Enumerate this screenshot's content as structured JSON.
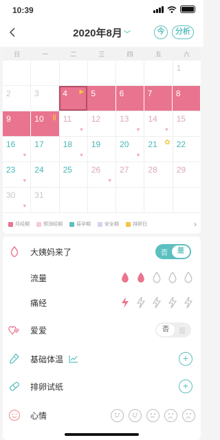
{
  "status_bar": {
    "time": "10:39"
  },
  "header": {
    "month_title": "2020年8月",
    "today_label": "今",
    "analyze_label": "分析"
  },
  "weekdays": [
    "日",
    "一",
    "二",
    "三",
    "四",
    "五",
    "六"
  ],
  "calendar": {
    "rows": [
      [
        {
          "d": ""
        },
        {
          "d": ""
        },
        {
          "d": ""
        },
        {
          "d": ""
        },
        {
          "d": ""
        },
        {
          "d": ""
        },
        {
          "d": "1",
          "c": "grey"
        }
      ],
      [
        {
          "d": "2",
          "c": "grey"
        },
        {
          "d": "3",
          "c": "grey"
        },
        {
          "d": "4",
          "c": "period",
          "sel": true,
          "mark": "flag"
        },
        {
          "d": "5",
          "c": "period"
        },
        {
          "d": "6",
          "c": "period"
        },
        {
          "d": "7",
          "c": "period"
        },
        {
          "d": "8",
          "c": "period"
        }
      ],
      [
        {
          "d": "9",
          "c": "period"
        },
        {
          "d": "10",
          "c": "period",
          "mark": "pause"
        },
        {
          "d": "11",
          "c": "pred",
          "heart": true
        },
        {
          "d": "12",
          "c": "pred"
        },
        {
          "d": "13",
          "c": "pred",
          "heart": true
        },
        {
          "d": "14",
          "c": "pred",
          "heart": true
        },
        {
          "d": "15",
          "c": "pred"
        }
      ],
      [
        {
          "d": "16",
          "c": "teal",
          "heart": true
        },
        {
          "d": "17",
          "c": "teal"
        },
        {
          "d": "18",
          "c": "teal",
          "heart": true
        },
        {
          "d": "19",
          "c": "teal"
        },
        {
          "d": "20",
          "c": "teal",
          "heart": true
        },
        {
          "d": "21",
          "c": "teal",
          "mark": "sun"
        },
        {
          "d": "22",
          "c": "teal"
        }
      ],
      [
        {
          "d": "23",
          "c": "teal",
          "heart": true
        },
        {
          "d": "24",
          "c": "teal"
        },
        {
          "d": "25",
          "c": "teal"
        },
        {
          "d": "26",
          "c": "pred",
          "heart": true
        },
        {
          "d": "27",
          "c": "pred"
        },
        {
          "d": "28",
          "c": "pred"
        },
        {
          "d": "29",
          "c": "pred"
        }
      ],
      [
        {
          "d": "30",
          "c": "grey",
          "heart": true
        },
        {
          "d": "31",
          "c": "grey"
        },
        {
          "d": ""
        },
        {
          "d": ""
        },
        {
          "d": ""
        },
        {
          "d": ""
        },
        {
          "d": ""
        }
      ]
    ]
  },
  "legend": [
    {
      "label": "月经期",
      "color": "#e9748f"
    },
    {
      "label": "预测经期",
      "color": "#f7c9d6"
    },
    {
      "label": "易孕期",
      "color": "#5dbfbf"
    },
    {
      "label": "安全期",
      "color": "#d9d0f0"
    },
    {
      "label": "排卵日",
      "color": "#f5c542"
    }
  ],
  "records": {
    "period": {
      "label": "大姨妈来了",
      "toggle_off": "否",
      "toggle_on": "是"
    },
    "flow": {
      "label": "流量"
    },
    "pain": {
      "label": "痛经"
    },
    "love": {
      "label": "爱爱",
      "toggle_off": "否",
      "toggle_on": "是"
    },
    "temp": {
      "label": "基础体温"
    },
    "ovulation": {
      "label": "排卵试纸"
    },
    "mood": {
      "label": "心情"
    }
  },
  "colors": {
    "accent": "#5dbfbf",
    "period": "#e9748f"
  }
}
